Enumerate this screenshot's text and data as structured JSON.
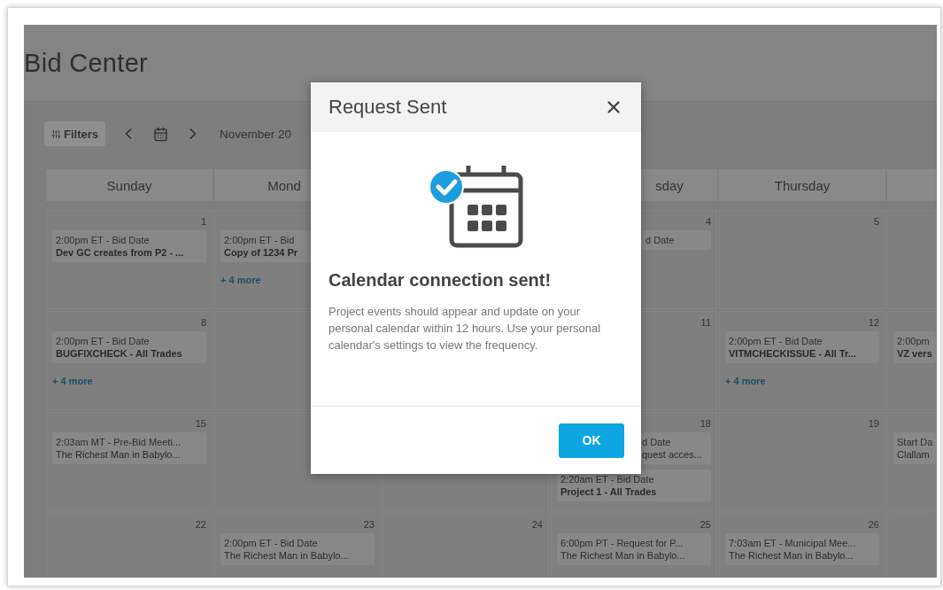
{
  "page": {
    "title": "Bid Center"
  },
  "toolbar": {
    "filters": "Filters",
    "month": "November 20"
  },
  "calendar": {
    "headers": {
      "sunday": "Sunday",
      "monday": "Mond",
      "wednesday": "sday",
      "thursday": "Thursday"
    },
    "weeks": [
      {
        "sunday": {
          "date": "1",
          "events": [
            {
              "time": "2:00pm ET - Bid Date",
              "title": "Dev GC creates from P2 - ...",
              "bold": true
            }
          ]
        },
        "monday": {
          "events": [
            {
              "time": "2:00pm ET - Bid",
              "title": "Copy of 1234 Pr",
              "bold": true
            }
          ],
          "more": "+ 4 more"
        },
        "wednesday": {
          "date": "4",
          "events": [
            {
              "time": "d Date"
            }
          ]
        },
        "thursday": {
          "date": "5"
        }
      },
      {
        "sunday": {
          "date": "8",
          "events": [
            {
              "time": "2:00pm ET - Bid Date",
              "title": "BUGFIXCHECK - All Trades",
              "bold": true
            }
          ],
          "more": "+ 4 more"
        },
        "wednesday": {
          "date": "11"
        },
        "thursday": {
          "date": "12",
          "events": [
            {
              "time": "2:00pm ET - Bid Date",
              "title": "VITMCHECKISSUE - All Tr...",
              "bold": true
            }
          ],
          "more": "+ 4 more"
        },
        "friday": {
          "events": [
            {
              "time": "2:00pm",
              "title": "VZ vers",
              "bold": true
            }
          ]
        }
      },
      {
        "sunday": {
          "date": "15",
          "events": [
            {
              "time": "2:03am MT - Pre-Bid Meeti...",
              "title": "The Richest Man in Babylo...",
              "bold": false
            }
          ]
        },
        "wednesday": {
          "date": "18",
          "events": [
            {
              "time": "d Date",
              "title": "quest acces...",
              "bold": false
            },
            {
              "time": "2:20am ET - Bid Date",
              "title": "Project 1 - All Trades",
              "bold": true
            }
          ]
        },
        "thursday": {
          "date": "19"
        },
        "friday": {
          "events": [
            {
              "time": "Start Da",
              "title": "Clallam",
              "bold": false
            }
          ]
        }
      },
      {
        "sunday": {
          "date": "22"
        },
        "monday": {
          "date": "23",
          "events": [
            {
              "time": "2:00pm ET - Bid Date",
              "title": "The Richest Man in Babylo...",
              "bold": false
            }
          ]
        },
        "tuesday": {
          "date": "24"
        },
        "wednesday": {
          "date": "25",
          "events": [
            {
              "time": "6:00pm PT - Request for P...",
              "title": "The Richest Man in Babylo...",
              "bold": false
            }
          ]
        },
        "thursday": {
          "date": "26",
          "events": [
            {
              "time": "7:03am ET - Municipal Mee...",
              "title": "The Richest Man in Babylo...",
              "bold": false
            }
          ]
        }
      }
    ]
  },
  "dialog": {
    "title": "Request Sent",
    "heading": "Calendar connection sent!",
    "message": "Project events should appear and update on your personal calendar within 12 hours. Use your personal calendar's settings to view the frequency.",
    "button": "OK"
  }
}
